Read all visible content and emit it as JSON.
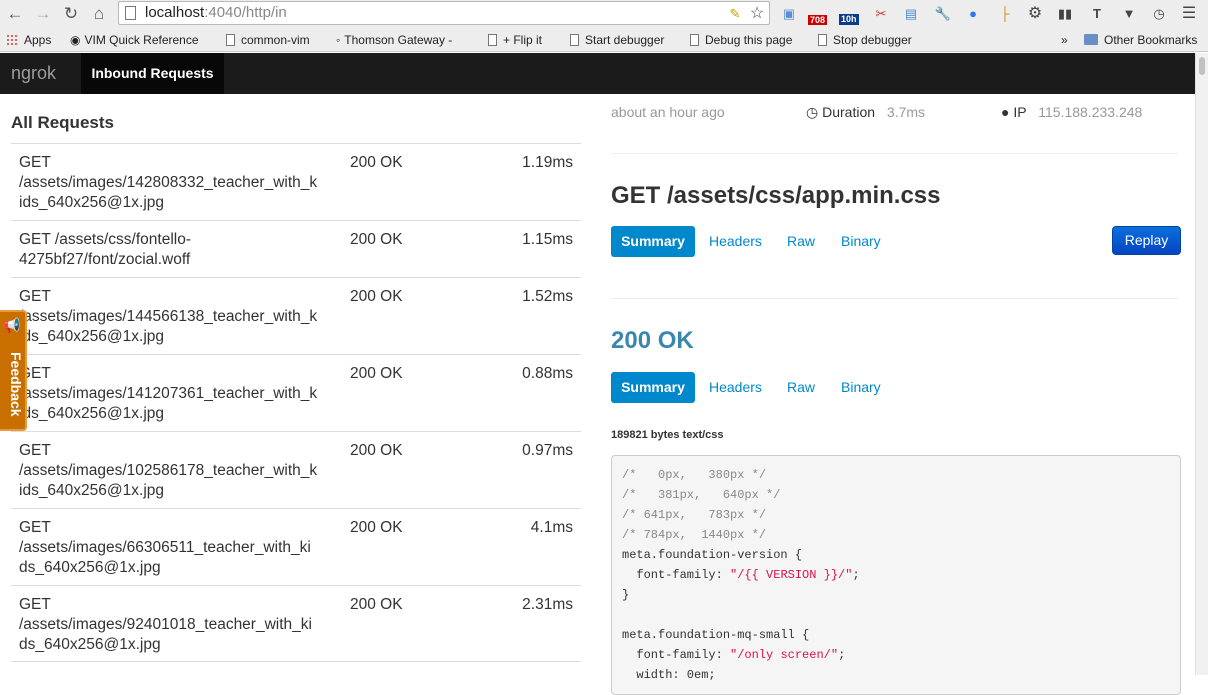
{
  "browser": {
    "url_host": "localhost",
    "url_rest": ":4040/http/in",
    "badges": {
      "mail_count": "708",
      "calendar": "10h"
    }
  },
  "bookmarks": [
    {
      "label": "Apps",
      "type": "apps"
    },
    {
      "label": "VIM Quick Reference",
      "type": "vim"
    },
    {
      "label": "common-vim",
      "type": "doc"
    },
    {
      "label": "Thomson Gateway -",
      "type": "globe"
    },
    {
      "label": "+ Flip it",
      "type": "doc"
    },
    {
      "label": "Start debugger",
      "type": "doc"
    },
    {
      "label": "Debug this page",
      "type": "doc"
    },
    {
      "label": "Stop debugger",
      "type": "doc"
    }
  ],
  "bookmarks_overflow": "»",
  "bookmarks_other": "Other Bookmarks",
  "navbar": {
    "brand": "ngrok",
    "active_item": "Inbound Requests"
  },
  "requests": {
    "heading": "All Requests",
    "rows": [
      {
        "path": "GET /assets/images/142808332_teacher_with_kids_640x256@1x.jpg",
        "status": "200 OK",
        "duration": "1.19ms"
      },
      {
        "path": "GET /assets/css/fontello-4275bf27/font/zocial.woff",
        "status": "200 OK",
        "duration": "1.15ms"
      },
      {
        "path": "GET /assets/images/144566138_teacher_with_kids_640x256@1x.jpg",
        "status": "200 OK",
        "duration": "1.52ms"
      },
      {
        "path": "GET /assets/images/141207361_teacher_with_kids_640x256@1x.jpg",
        "status": "200 OK",
        "duration": "0.88ms"
      },
      {
        "path": "GET /assets/images/102586178_teacher_with_kids_640x256@1x.jpg",
        "status": "200 OK",
        "duration": "0.97ms"
      },
      {
        "path": "GET /assets/images/66306511_teacher_with_kids_640x256@1x.jpg",
        "status": "200 OK",
        "duration": "4.1ms"
      },
      {
        "path": "GET /assets/images/92401018_teacher_with_kids_640x256@1x.jpg",
        "status": "200 OK",
        "duration": "2.31ms"
      }
    ]
  },
  "feedback": {
    "label": "Feedback"
  },
  "detail": {
    "time_ago": "about an hour ago",
    "duration_label": "Duration",
    "duration_value": "3.7ms",
    "ip_label": "IP",
    "ip_value": "115.188.233.248",
    "request_title": "GET /assets/css/app.min.css",
    "request_tabs": [
      "Summary",
      "Headers",
      "Raw",
      "Binary"
    ],
    "replay_label": "Replay",
    "response_title": "200 OK",
    "response_tabs": [
      "Summary",
      "Headers",
      "Raw",
      "Binary"
    ],
    "bytes_info": "189821 bytes text/css",
    "code_lines": [
      "/*   0px,   380px */",
      "/*   381px,   640px */",
      "/* 641px,   783px */",
      "/* 784px,  1440px */",
      "meta.foundation-version {",
      "  font-family: \"/{{ VERSION }}/\";",
      "}",
      "",
      "meta.foundation-mq-small {",
      "  font-family: \"/only screen/\";",
      "  width: 0em;"
    ]
  }
}
